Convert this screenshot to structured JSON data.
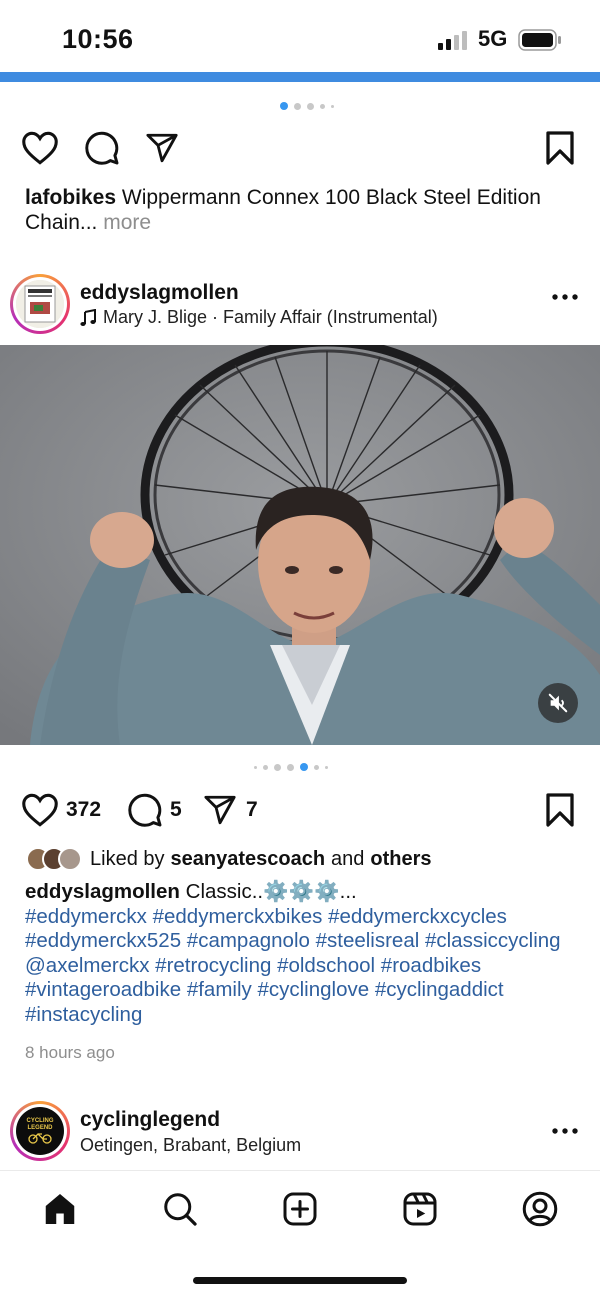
{
  "status_bar": {
    "time": "10:56",
    "network": "5G"
  },
  "post_prev": {
    "username": "lafobikes",
    "caption": "Wippermann Connex 100 Black Steel Edition Chain...",
    "more_label": "more",
    "carousel": {
      "count": 5,
      "active_index": 0
    }
  },
  "post": {
    "username": "eddyslagmollen",
    "audio": "Mary J. Blige · Family Affair (Instrumental)",
    "more_icon": "more-horizontal-icon",
    "carousel": {
      "count": 7,
      "active_index": 4
    },
    "like_count": "372",
    "comment_count": "5",
    "share_count": "7",
    "liked_by_prefix": "Liked by",
    "liked_by_user": "seanyatescoach",
    "liked_by_and": "and",
    "liked_by_others": "others",
    "caption_user": "eddyslagmollen",
    "caption_text": "Classic..⚙️⚙️⚙️...",
    "hashtags": "#eddymerckx #eddymerckxbikes #eddymerckxcycles #eddymerckx525 #campagnolo #steelisreal #classiccycling @axelmerckx #retrocycling #oldschool #roadbikes #vintageroadbike #family #cyclinglove #cyclingaddict #instacycling",
    "time_ago": "8 hours ago"
  },
  "post_next": {
    "username": "cyclinglegend",
    "location": "Oetingen, Brabant, Belgium",
    "avatar_text": "CYCLING LEGEND"
  },
  "nav": {
    "items": [
      "home-icon",
      "search-icon",
      "create-icon",
      "reels-icon",
      "profile-icon"
    ]
  },
  "colors": {
    "accent_blue": "#3f8be0",
    "hashtag": "#2f5f9e",
    "muted": "#8e8e8e"
  }
}
